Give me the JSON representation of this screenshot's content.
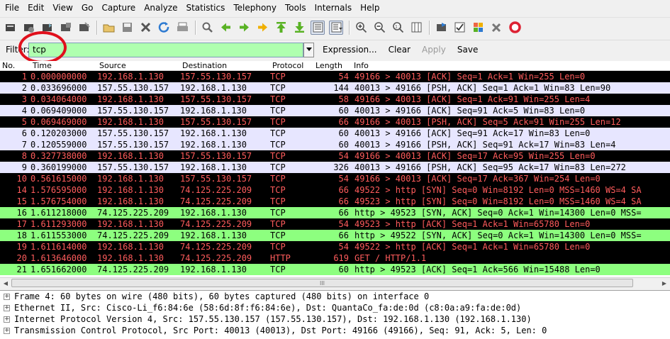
{
  "menu": [
    "File",
    "Edit",
    "View",
    "Go",
    "Capture",
    "Analyze",
    "Statistics",
    "Telephony",
    "Tools",
    "Internals",
    "Help"
  ],
  "toolbar_icons": [
    "interface-list-icon",
    "capture-options-icon",
    "start-capture-icon",
    "stop-capture-icon",
    "restart-capture-icon",
    "open-file-icon",
    "save-file-icon",
    "close-file-icon",
    "reload-icon",
    "print-icon",
    "find-packet-icon",
    "go-back-icon",
    "go-forward-icon",
    "go-to-packet-icon",
    "go-first-icon",
    "go-last-icon",
    "colorize-icon",
    "auto-scroll-icon",
    "zoom-in-icon",
    "zoom-out-icon",
    "zoom-normal-icon",
    "resize-columns-icon",
    "capture-filters-icon",
    "display-filters-icon",
    "coloring-rules-icon",
    "preferences-icon",
    "help-icon"
  ],
  "filter": {
    "label": "Filter:",
    "value": "tcp",
    "buttons": {
      "expression": "Expression...",
      "clear": "Clear",
      "apply": "Apply",
      "save": "Save"
    }
  },
  "packet_list": {
    "columns": [
      "No.",
      "Time",
      "Source",
      "Destination",
      "Protocol",
      "Length",
      "Info"
    ],
    "rows": [
      {
        "no": "1",
        "time": "0.000000000",
        "src": "192.168.1.130",
        "dst": "157.55.130.157",
        "proto": "TCP",
        "len": "54",
        "info": "49166 > 40013 [ACK] Seq=1 Ack=1 Win=255 Len=0",
        "bg": "#000000",
        "fg": "#ff5c5c"
      },
      {
        "no": "2",
        "time": "0.033696000",
        "src": "157.55.130.157",
        "dst": "192.168.1.130",
        "proto": "TCP",
        "len": "144",
        "info": "40013 > 49166 [PSH, ACK] Seq=1 Ack=1 Win=83 Len=90",
        "bg": "#e7e6ff",
        "fg": "#000000"
      },
      {
        "no": "3",
        "time": "0.034064000",
        "src": "192.168.1.130",
        "dst": "157.55.130.157",
        "proto": "TCP",
        "len": "58",
        "info": "49166 > 40013 [ACK] Seq=1 Ack=91 Win=255 Len=4",
        "bg": "#000000",
        "fg": "#ff5c5c"
      },
      {
        "no": "4",
        "time": "0.069409000",
        "src": "157.55.130.157",
        "dst": "192.168.1.130",
        "proto": "TCP",
        "len": "60",
        "info": "40013 > 49166 [ACK] Seq=91 Ack=5 Win=83 Len=0",
        "bg": "#e7e6ff",
        "fg": "#000000"
      },
      {
        "no": "5",
        "time": "0.069469000",
        "src": "192.168.1.130",
        "dst": "157.55.130.157",
        "proto": "TCP",
        "len": "66",
        "info": "49166 > 40013 [PSH, ACK] Seq=5 Ack=91 Win=255 Len=12",
        "bg": "#000000",
        "fg": "#ff5c5c"
      },
      {
        "no": "6",
        "time": "0.120203000",
        "src": "157.55.130.157",
        "dst": "192.168.1.130",
        "proto": "TCP",
        "len": "60",
        "info": "40013 > 49166 [ACK] Seq=91 Ack=17 Win=83 Len=0",
        "bg": "#e7e6ff",
        "fg": "#000000"
      },
      {
        "no": "7",
        "time": "0.120559000",
        "src": "157.55.130.157",
        "dst": "192.168.1.130",
        "proto": "TCP",
        "len": "60",
        "info": "40013 > 49166 [PSH, ACK] Seq=91 Ack=17 Win=83 Len=4",
        "bg": "#e7e6ff",
        "fg": "#000000"
      },
      {
        "no": "8",
        "time": "0.327738000",
        "src": "192.168.1.130",
        "dst": "157.55.130.157",
        "proto": "TCP",
        "len": "54",
        "info": "49166 > 40013 [ACK] Seq=17 Ack=95 Win=255 Len=0",
        "bg": "#000000",
        "fg": "#ff5c5c"
      },
      {
        "no": "9",
        "time": "0.360199000",
        "src": "157.55.130.157",
        "dst": "192.168.1.130",
        "proto": "TCP",
        "len": "326",
        "info": "40013 > 49166 [PSH, ACK] Seq=95 Ack=17 Win=83 Len=272",
        "bg": "#e7e6ff",
        "fg": "#000000"
      },
      {
        "no": "10",
        "time": "0.561615000",
        "src": "192.168.1.130",
        "dst": "157.55.130.157",
        "proto": "TCP",
        "len": "54",
        "info": "49166 > 40013 [ACK] Seq=17 Ack=367 Win=254 Len=0",
        "bg": "#000000",
        "fg": "#ff5c5c"
      },
      {
        "no": "14",
        "time": "1.576595000",
        "src": "192.168.1.130",
        "dst": "74.125.225.209",
        "proto": "TCP",
        "len": "66",
        "info": "49522 > http [SYN] Seq=0 Win=8192 Len=0 MSS=1460 WS=4 SA",
        "bg": "#000000",
        "fg": "#ff5c5c"
      },
      {
        "no": "15",
        "time": "1.576754000",
        "src": "192.168.1.130",
        "dst": "74.125.225.209",
        "proto": "TCP",
        "len": "66",
        "info": "49523 > http [SYN] Seq=0 Win=8192 Len=0 MSS=1460 WS=4 SA",
        "bg": "#000000",
        "fg": "#ff5c5c"
      },
      {
        "no": "16",
        "time": "1.611218000",
        "src": "74.125.225.209",
        "dst": "192.168.1.130",
        "proto": "TCP",
        "len": "66",
        "info": "http > 49523 [SYN, ACK] Seq=0 Ack=1 Win=14300 Len=0 MSS=",
        "bg": "#8dff7f",
        "fg": "#000000"
      },
      {
        "no": "17",
        "time": "1.611293000",
        "src": "192.168.1.130",
        "dst": "74.125.225.209",
        "proto": "TCP",
        "len": "54",
        "info": "49523 > http [ACK] Seq=1 Ack=1 Win=65780 Len=0",
        "bg": "#000000",
        "fg": "#ff5c5c"
      },
      {
        "no": "18",
        "time": "1.611553000",
        "src": "74.125.225.209",
        "dst": "192.168.1.130",
        "proto": "TCP",
        "len": "66",
        "info": "http > 49522 [SYN, ACK] Seq=0 Ack=1 Win=14300 Len=0 MSS=",
        "bg": "#8dff7f",
        "fg": "#000000"
      },
      {
        "no": "19",
        "time": "1.611614000",
        "src": "192.168.1.130",
        "dst": "74.125.225.209",
        "proto": "TCP",
        "len": "54",
        "info": "49522 > http [ACK] Seq=1 Ack=1 Win=65780 Len=0",
        "bg": "#000000",
        "fg": "#ff5c5c"
      },
      {
        "no": "20",
        "time": "1.613646000",
        "src": "192.168.1.130",
        "dst": "74.125.225.209",
        "proto": "HTTP",
        "len": "619",
        "info": "GET / HTTP/1.1",
        "bg": "#000000",
        "fg": "#ff5c5c"
      },
      {
        "no": "21",
        "time": "1.651662000",
        "src": "74.125.225.209",
        "dst": "192.168.1.130",
        "proto": "TCP",
        "len": "60",
        "info": "http > 49523 [ACK] Seq=1 Ack=566 Win=15488 Len=0",
        "bg": "#8dff7f",
        "fg": "#000000"
      }
    ]
  },
  "scrollbar": {
    "grip": "III"
  },
  "details": [
    "Frame 4: 60 bytes on wire (480 bits), 60 bytes captured (480 bits) on interface 0",
    "Ethernet II, Src: Cisco-Li_f6:84:6e (58:6d:8f:f6:84:6e), Dst: QuantaCo_fa:de:0d (c8:0a:a9:fa:de:0d)",
    "Internet Protocol Version 4, Src: 157.55.130.157 (157.55.130.157), Dst: 192.168.1.130 (192.168.1.130)",
    "Transmission Control Protocol, Src Port: 40013 (40013), Dst Port: 49166 (49166), Seq: 91, Ack: 5, Len: 0"
  ],
  "colors": {
    "filter_ok_bg": "#afffaf",
    "annotation_circle": "#e0101c"
  }
}
